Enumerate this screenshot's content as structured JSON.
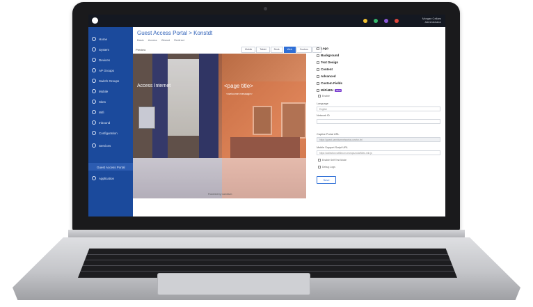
{
  "user": {
    "line1": "Morgan Cellars",
    "line2": "Administrator"
  },
  "colors": {
    "accent": "#2f6fd6",
    "sidebar": "#1b4a9c",
    "topbar": "#141821",
    "badge": "#7b3fd0"
  },
  "sidebar": {
    "items": [
      {
        "label": "Home",
        "icon": "home-icon"
      },
      {
        "label": "System",
        "icon": "system-icon"
      },
      {
        "label": "Devices",
        "icon": "devices-icon"
      },
      {
        "label": "AP Groups",
        "icon": "ap-groups-icon"
      },
      {
        "label": "Switch Groups",
        "icon": "switch-groups-icon"
      },
      {
        "label": "Mobile",
        "icon": "mobile-icon"
      },
      {
        "label": "Sites",
        "icon": "sites-icon"
      },
      {
        "label": "Wifi",
        "icon": "wifi-icon"
      },
      {
        "label": "Inbound",
        "icon": "inbound-icon"
      },
      {
        "label": "Configuration",
        "icon": "gear-icon"
      },
      {
        "label": "Services",
        "icon": "services-icon"
      },
      {
        "label": "Guest Access Portal",
        "icon": ""
      },
      {
        "label": "Application",
        "icon": "application-icon"
      }
    ]
  },
  "main": {
    "title": "Guest Access Portal > Konstdt",
    "tabs": [
      "Basic",
      "Access",
      "Wizard",
      "Redirect"
    ],
    "preview_label": "Preview",
    "preview_buttons": [
      "Mobile",
      "Tablet",
      "Desk",
      "Web",
      "Custom"
    ],
    "preview": {
      "access_text": "Access Internet",
      "page_title": "<page title>",
      "welcome": "<welcome message>",
      "powered": "Powered by Cambium"
    }
  },
  "settings": {
    "sections": [
      "Logo",
      "Background",
      "Text Design",
      "Content",
      "Advanced",
      "Custom Fields",
      "WiFi4EU"
    ],
    "badge": "NEW",
    "enable_label": "Enable",
    "language_label": "Language",
    "language_value": "English",
    "network_id_label": "Network ID",
    "captive_label": "Captive Portal URL",
    "captive_value": "https://guest.cambiumnetworks.com/cn-rtr/",
    "mobile_label": "Mobile Support Script URL",
    "mobile_value": "https://collection.wifi4eu.ec.europa.eu/wifi4eu.min.js",
    "self_test": "Enable Self Test Mode",
    "debug": "Debug Logs",
    "save": "Save"
  }
}
